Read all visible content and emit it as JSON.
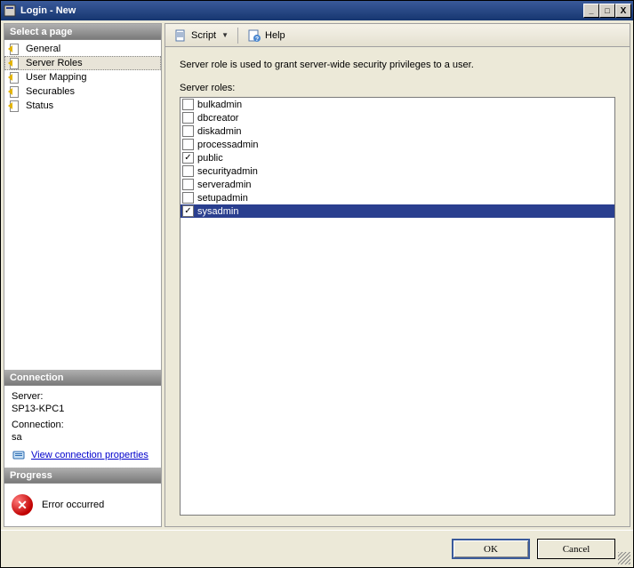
{
  "window": {
    "title": "Login - New",
    "buttons": {
      "min": "_",
      "max": "□",
      "close": "X"
    }
  },
  "sidebar": {
    "select_page_header": "Select a page",
    "pages": [
      "General",
      "Server Roles",
      "User Mapping",
      "Securables",
      "Status"
    ],
    "selected_index": 1
  },
  "connection": {
    "header": "Connection",
    "server_label": "Server:",
    "server_value": "SP13-KPC1",
    "connection_label": "Connection:",
    "connection_value": "sa",
    "link_text": "View connection properties"
  },
  "progress": {
    "header": "Progress",
    "status_text": "Error occurred",
    "icon_glyph": "✕"
  },
  "toolbar": {
    "script_label": "Script",
    "help_label": "Help"
  },
  "main": {
    "description": "Server role is used to grant server-wide security privileges to a user.",
    "roles_label": "Server roles:",
    "roles": [
      {
        "name": "bulkadmin",
        "checked": false,
        "selected": false
      },
      {
        "name": "dbcreator",
        "checked": false,
        "selected": false
      },
      {
        "name": "diskadmin",
        "checked": false,
        "selected": false
      },
      {
        "name": "processadmin",
        "checked": false,
        "selected": false
      },
      {
        "name": "public",
        "checked": true,
        "selected": false
      },
      {
        "name": "securityadmin",
        "checked": false,
        "selected": false
      },
      {
        "name": "serveradmin",
        "checked": false,
        "selected": false
      },
      {
        "name": "setupadmin",
        "checked": false,
        "selected": false
      },
      {
        "name": "sysadmin",
        "checked": true,
        "selected": true
      }
    ]
  },
  "buttons": {
    "ok": "OK",
    "cancel": "Cancel"
  }
}
